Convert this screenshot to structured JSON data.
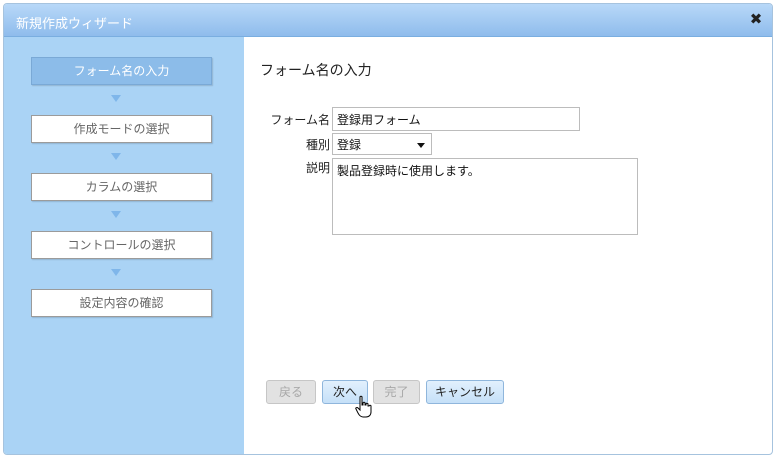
{
  "window": {
    "title": "新規作成ウィザード",
    "close_icon": "close-icon"
  },
  "sidebar": {
    "steps": [
      {
        "label": "フォーム名の入力",
        "active": true
      },
      {
        "label": "作成モードの選択",
        "active": false
      },
      {
        "label": "カラムの選択",
        "active": false
      },
      {
        "label": "コントロールの選択",
        "active": false
      },
      {
        "label": "設定内容の確認",
        "active": false
      }
    ]
  },
  "main": {
    "heading": "フォーム名の入力",
    "form": {
      "name_label": "フォーム名",
      "name_value": "登録用フォーム",
      "type_label": "種別",
      "type_value": "登録",
      "desc_label": "説明",
      "desc_value": "製品登録時に使用します。"
    }
  },
  "buttons": {
    "back": "戻る",
    "next": "次へ",
    "finish": "完了",
    "cancel": "キャンセル"
  }
}
